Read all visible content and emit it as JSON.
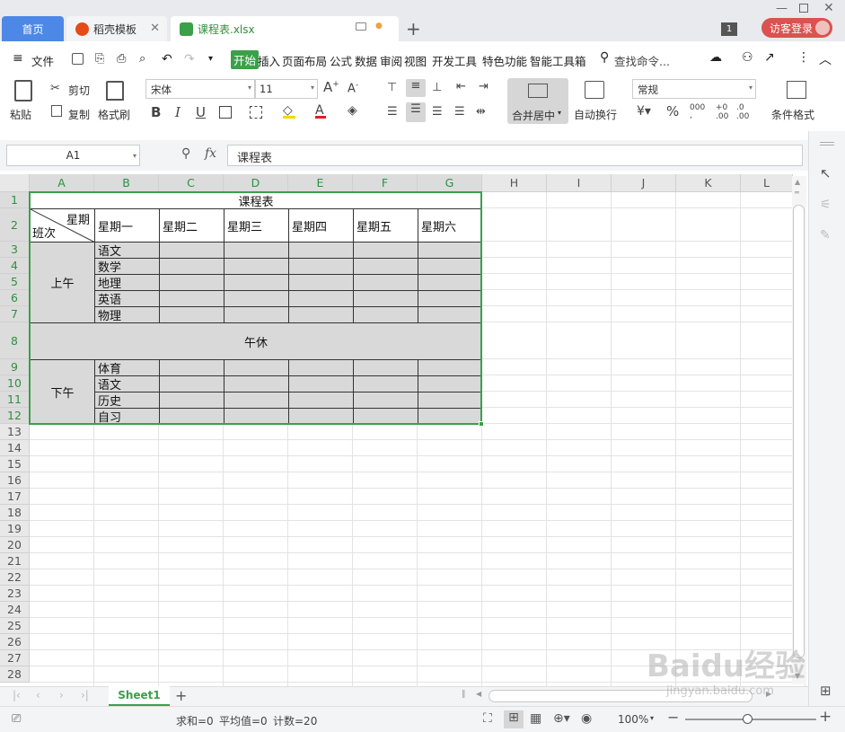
{
  "titlebar": {
    "home_tab": "首页",
    "tabs": [
      {
        "label": "稻壳模板",
        "close": "✕"
      },
      {
        "label": "课程表.xlsx",
        "dot": "●"
      }
    ],
    "add_tab": "+",
    "badge": "1",
    "login": "访客登录"
  },
  "menu": {
    "file": "文件",
    "items": [
      "开始",
      "插入",
      "页面布局",
      "公式",
      "数据",
      "审阅",
      "视图",
      "开发工具",
      "特色功能",
      "智能工具箱"
    ],
    "search": "查找命令..."
  },
  "ribbon": {
    "paste": "粘贴",
    "cut": "剪切",
    "copy": "复制",
    "format_painter": "格式刷",
    "font_name": "宋体",
    "font_size": "11",
    "merge": "合并居中",
    "wrap": "自动换行",
    "number_format": "常规",
    "cond_format": "条件格式",
    "bold": "B",
    "italic": "I",
    "underline": "U"
  },
  "formula_bar": {
    "name_box": "A1",
    "fx": "fx",
    "content": "课程表"
  },
  "columns": [
    "A",
    "B",
    "C",
    "D",
    "E",
    "F",
    "G",
    "H",
    "I",
    "J",
    "K",
    "L"
  ],
  "rows": [
    "1",
    "2",
    "3",
    "4",
    "5",
    "6",
    "7",
    "8",
    "9",
    "10",
    "11",
    "12",
    "13",
    "14",
    "15",
    "16",
    "17",
    "18",
    "19",
    "20",
    "21",
    "22",
    "23",
    "24",
    "25",
    "26",
    "27",
    "28"
  ],
  "sheet": {
    "title": "课程表",
    "corner_top": "星期",
    "corner_bottom": "班次",
    "days": [
      "星期一",
      "星期二",
      "星期三",
      "星期四",
      "星期五",
      "星期六"
    ],
    "morning_label": "上午",
    "morning_subjects": [
      "语文",
      "数学",
      "地理",
      "英语",
      "物理"
    ],
    "noon_label": "午休",
    "afternoon_label": "下午",
    "afternoon_subjects": [
      "体育",
      "语文",
      "历史",
      "自习"
    ]
  },
  "sheet_tabs": {
    "active": "Sheet1",
    "add": "+"
  },
  "status": {
    "sum": "求和=0",
    "avg": "平均值=0",
    "count": "计数=20",
    "zoom": "100%"
  },
  "watermark": {
    "main": "Baidu经验",
    "sub": "jingyan.baidu.com"
  }
}
